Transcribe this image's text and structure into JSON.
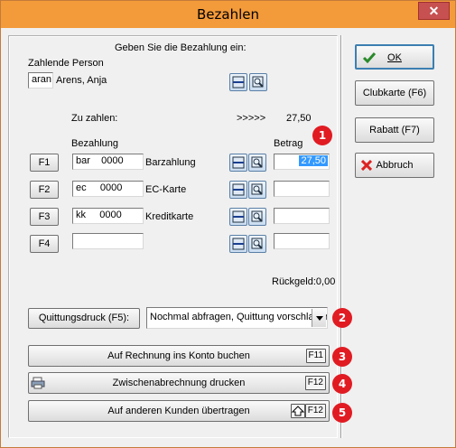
{
  "window": {
    "title": "Bezahlen",
    "close_glyph": "✕"
  },
  "prompt": "Geben Sie die Bezahlung ein:",
  "payer": {
    "label": "Zahlende Person",
    "code": "aran",
    "name": "Arens, Anja"
  },
  "due": {
    "label": "Zu zahlen:",
    "arrows": ">>>>>",
    "amount": "27,50"
  },
  "headers": {
    "payment": "Bezahlung",
    "amount": "Betrag"
  },
  "payments": [
    {
      "fkey": "F1",
      "code": "bar",
      "num": "0000",
      "name": "Barzahlung",
      "amount": "27,50"
    },
    {
      "fkey": "F2",
      "code": "ec",
      "num": "0000",
      "name": "EC-Karte",
      "amount": ""
    },
    {
      "fkey": "F3",
      "code": "kk",
      "num": "0000",
      "name": "Kreditkarte",
      "amount": ""
    },
    {
      "fkey": "F4",
      "code": "",
      "num": "",
      "name": "",
      "amount": ""
    }
  ],
  "change": {
    "label": "Rückgeld:",
    "value": "0,00"
  },
  "receipt": {
    "button": "Quittungsdruck (F5):",
    "select_value": "Nochmal abfragen, Quittung vorschlagen"
  },
  "actions": {
    "account": {
      "label": "Auf Rechnung ins Konto buchen",
      "key": "F11"
    },
    "interim": {
      "label": "Zwischenabrechnung drucken",
      "key": "F12"
    },
    "transfer": {
      "label": "Auf anderen Kunden übertragen",
      "key": "F12"
    }
  },
  "side": {
    "ok": "OK",
    "clubcard": "Clubkarte (F6)",
    "discount": "Rabatt (F7)",
    "cancel": "Abbruch"
  },
  "badges": [
    "1",
    "2",
    "3",
    "4",
    "5"
  ],
  "colors": {
    "titlebar": "#f39a3a",
    "badge": "#e11b22",
    "selection": "#3399ff",
    "close": "#c75050"
  },
  "icons": [
    "calculator-icon",
    "search-icon",
    "check-icon",
    "cancel-x-icon",
    "printer-icon",
    "shift-arrow-icon",
    "dropdown-arrow-icon"
  ]
}
